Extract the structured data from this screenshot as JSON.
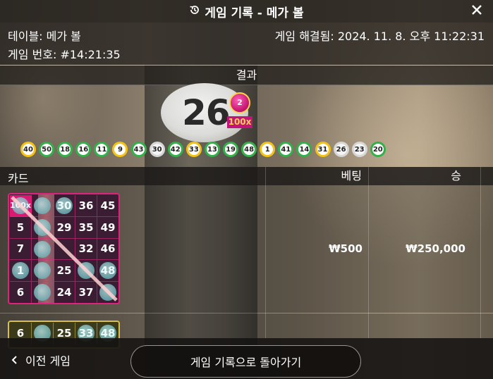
{
  "header": {
    "title": "게임 기록 - 메가 볼",
    "close_icon": "close-icon",
    "history_icon": "history-icon"
  },
  "info": {
    "table": "테이블: 메가 볼",
    "game_number": "게임 번호: #14:21:35",
    "resolved": "게임 해결됨: 2024. 11. 8. 오후 11:22:31"
  },
  "result": {
    "label": "결과",
    "number": "26",
    "mega_ball": "2",
    "multiplier": "100x",
    "balls": [
      {
        "n": "40",
        "c": "y"
      },
      {
        "n": "50",
        "c": "g"
      },
      {
        "n": "18",
        "c": "g"
      },
      {
        "n": "16",
        "c": "g"
      },
      {
        "n": "11",
        "c": "g"
      },
      {
        "n": "9",
        "c": "y"
      },
      {
        "n": "43",
        "c": "g"
      },
      {
        "n": "30",
        "c": "w"
      },
      {
        "n": "42",
        "c": "g"
      },
      {
        "n": "33",
        "c": "y"
      },
      {
        "n": "13",
        "c": "g"
      },
      {
        "n": "19",
        "c": "g"
      },
      {
        "n": "48",
        "c": "g"
      },
      {
        "n": "1",
        "c": "y"
      },
      {
        "n": "41",
        "c": "g"
      },
      {
        "n": "14",
        "c": "g"
      },
      {
        "n": "31",
        "c": "y"
      },
      {
        "n": "26",
        "c": "w"
      },
      {
        "n": "23",
        "c": "w"
      },
      {
        "n": "20",
        "c": "g"
      }
    ]
  },
  "table": {
    "col_card": "카드",
    "col_bet": "베팅",
    "col_win": "승",
    "rows": [
      {
        "bet": "₩500",
        "win": "₩250,000",
        "card": [
          [
            "100x",
            "",
            "30",
            "36",
            "45"
          ],
          [
            "5",
            "",
            "29",
            "35",
            "49"
          ],
          [
            "7",
            "",
            "",
            "32",
            "46"
          ],
          [
            "1",
            "",
            "25",
            "",
            "48"
          ],
          [
            "6",
            "",
            "24",
            "37",
            ""
          ]
        ],
        "marked": [
          [
            true,
            true,
            true,
            false,
            false
          ],
          [
            false,
            true,
            false,
            false,
            false
          ],
          [
            false,
            true,
            false,
            false,
            false
          ],
          [
            true,
            true,
            false,
            true,
            true
          ],
          [
            false,
            true,
            false,
            false,
            true
          ]
        ]
      },
      {
        "card": [
          [
            "6",
            "",
            "25",
            "33",
            "48"
          ]
        ],
        "marked": [
          [
            false,
            true,
            false,
            true,
            true
          ]
        ]
      }
    ]
  },
  "footer": {
    "prev_label": "이전 게임",
    "back_label": "게임 기록으로 돌아가기"
  }
}
